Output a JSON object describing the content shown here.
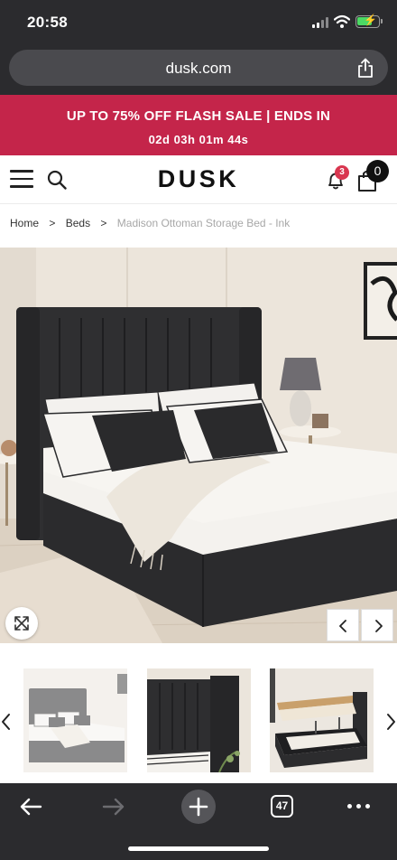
{
  "status_bar": {
    "time": "20:58"
  },
  "browser": {
    "url": "dusk.com",
    "open_tabs": "47"
  },
  "promo": {
    "headline": "UP TO 75% OFF FLASH SALE | ENDS IN",
    "countdown": "02d 03h 01m 44s"
  },
  "header": {
    "logo": "DUSK",
    "notification_count": "3",
    "basket_count": "0"
  },
  "breadcrumb": {
    "home": "Home",
    "category": "Beds",
    "current": "Madison Ottoman Storage Bed - Ink"
  },
  "gallery": {
    "prev_glyph": "‹",
    "next_glyph": "›",
    "thumbnail_count": 3,
    "selected_thumbnail": 1
  },
  "colors": {
    "promo_bg": "#c4254a",
    "badge_red": "#d9364f",
    "browser_chrome": "#2b2b2e",
    "bed_fabric": "#2d2d2f"
  }
}
